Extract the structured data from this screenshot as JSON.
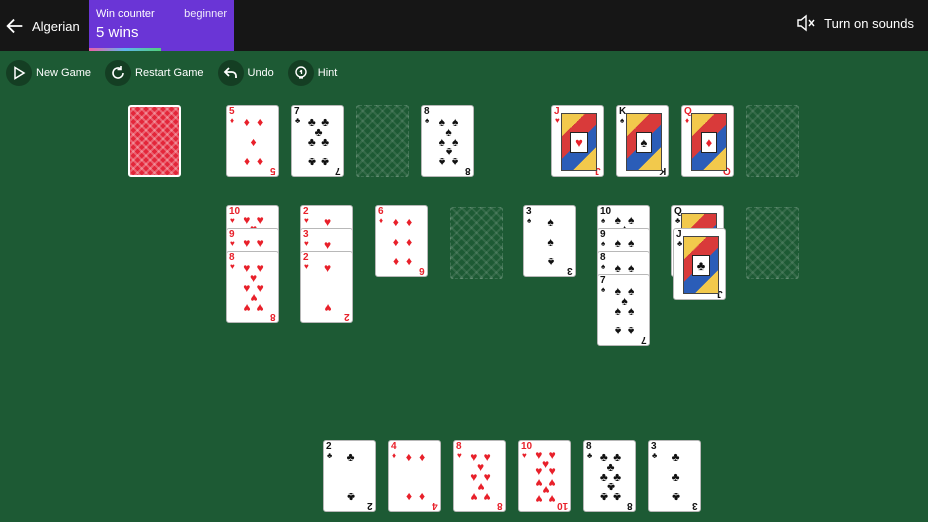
{
  "header": {
    "title": "Algerian",
    "win_counter_label": "Win counter",
    "level": "beginner",
    "wins": "5 wins",
    "sound_label": "Turn on sounds"
  },
  "toolbar": {
    "new_game": "New Game",
    "restart": "Restart Game",
    "undo": "Undo",
    "hint": "Hint"
  },
  "colors": {
    "felt": "#1d5a34",
    "topbar": "#161616",
    "accent": "#6a35d6",
    "red_suit": "#e8202a"
  },
  "board": {
    "stock": {
      "face_down": true
    },
    "reserve_top": [
      {
        "rank": "5",
        "suit": "♦"
      },
      {
        "rank": "7",
        "suit": "♣"
      },
      null,
      {
        "rank": "8",
        "suit": "♠"
      }
    ],
    "foundations": [
      {
        "rank": "J",
        "suit": "♥"
      },
      {
        "rank": "K",
        "suit": "♠"
      },
      {
        "rank": "Q",
        "suit": "♦"
      },
      null
    ],
    "tableau": [
      [
        {
          "rank": "10",
          "suit": "♥"
        },
        {
          "rank": "9",
          "suit": "♥"
        },
        {
          "rank": "8",
          "suit": "♥"
        }
      ],
      [
        {
          "rank": "2",
          "suit": "♥"
        },
        {
          "rank": "3",
          "suit": "♥"
        },
        {
          "rank": "2",
          "suit": "♥"
        }
      ],
      [
        {
          "rank": "6",
          "suit": "♦"
        }
      ],
      [],
      [
        {
          "rank": "3",
          "suit": "♠"
        }
      ],
      [
        {
          "rank": "10",
          "suit": "♠"
        },
        {
          "rank": "9",
          "suit": "♠"
        },
        {
          "rank": "8",
          "suit": "♠"
        },
        {
          "rank": "7",
          "suit": "♠"
        }
      ],
      [
        {
          "rank": "Q",
          "suit": "♣"
        },
        {
          "rank": "J",
          "suit": "♣"
        }
      ],
      []
    ],
    "bottom_row": [
      {
        "rank": "2",
        "suit": "♣"
      },
      {
        "rank": "4",
        "suit": "♦"
      },
      {
        "rank": "8",
        "suit": "♥"
      },
      {
        "rank": "10",
        "suit": "♥"
      },
      {
        "rank": "8",
        "suit": "♣"
      },
      {
        "rank": "3",
        "suit": "♣"
      }
    ]
  }
}
